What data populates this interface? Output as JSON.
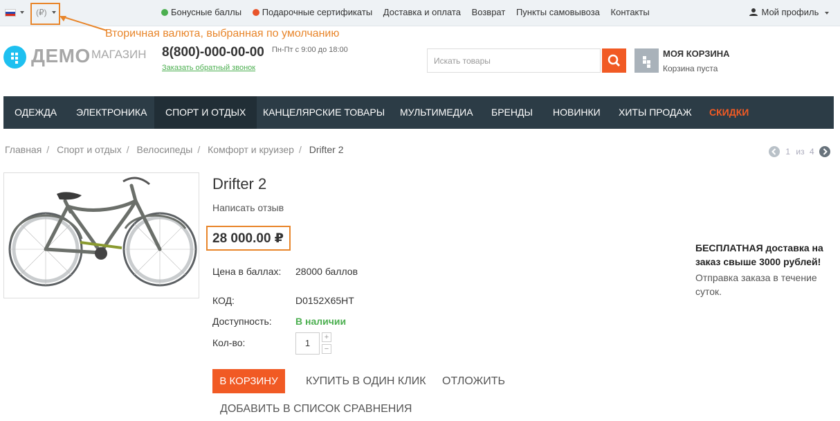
{
  "topbar": {
    "currency": "(₽)",
    "links": [
      "Бонусные баллы",
      "Подарочные сертификаты",
      "Доставка и оплата",
      "Возврат",
      "Пункты самовывоза",
      "Контакты"
    ],
    "profile": "Мой профиль"
  },
  "annotation": "Вторичная валюта, выбранная по умолчанию",
  "header": {
    "logo_main": "ДЕМО",
    "logo_sub": "МАГАЗИН",
    "phone": "8(800)-000-00-00",
    "hours": "Пн-Пт с 9:00 до 18:00",
    "callback": "Заказать обратный звонок",
    "search_placeholder": "Искать товары",
    "cart_title": "МОЯ КОРЗИНА",
    "cart_status": "Корзина пуста"
  },
  "nav": [
    "ОДЕЖДА",
    "ЭЛЕКТРОНИКА",
    "СПОРТ И ОТДЫХ",
    "КАНЦЕЛЯРСКИЕ ТОВАРЫ",
    "МУЛЬТИМЕДИА",
    "БРЕНДЫ",
    "НОВИНКИ",
    "ХИТЫ ПРОДАЖ",
    "СКИДКИ"
  ],
  "breadcrumbs": [
    "Главная",
    "Спорт и отдых",
    "Велосипеды",
    "Комфорт и круизер",
    "Drifter 2"
  ],
  "pager": {
    "current": "1",
    "of": "из",
    "total": "4"
  },
  "product": {
    "title": "Drifter 2",
    "review": "Написать отзыв",
    "price": "28 000.00 ₽",
    "points_label": "Цена в баллах:",
    "points_value": "28000 баллов",
    "code_label": "КОД:",
    "code_value": "D0152X65HT",
    "avail_label": "Доступность:",
    "avail_value": "В наличии",
    "qty_label": "Кол-во:",
    "qty_value": "1",
    "add_to_cart": "В КОРЗИНУ",
    "one_click": "КУПИТЬ В ОДИН КЛИК",
    "defer": "ОТЛОЖИТЬ",
    "compare": "ДОБАВИТЬ В СПИСОК СРАВНЕНИЯ"
  },
  "delivery": {
    "headline": "БЕСПЛАТНАЯ доставка на заказ свыше 3000 рублей!",
    "text": "Отправка заказа в течение суток."
  },
  "colors": {
    "accent": "#f15a24",
    "nav_bg": "#2c3c46",
    "annotation": "#e8852a",
    "in_stock": "#4caf50"
  }
}
